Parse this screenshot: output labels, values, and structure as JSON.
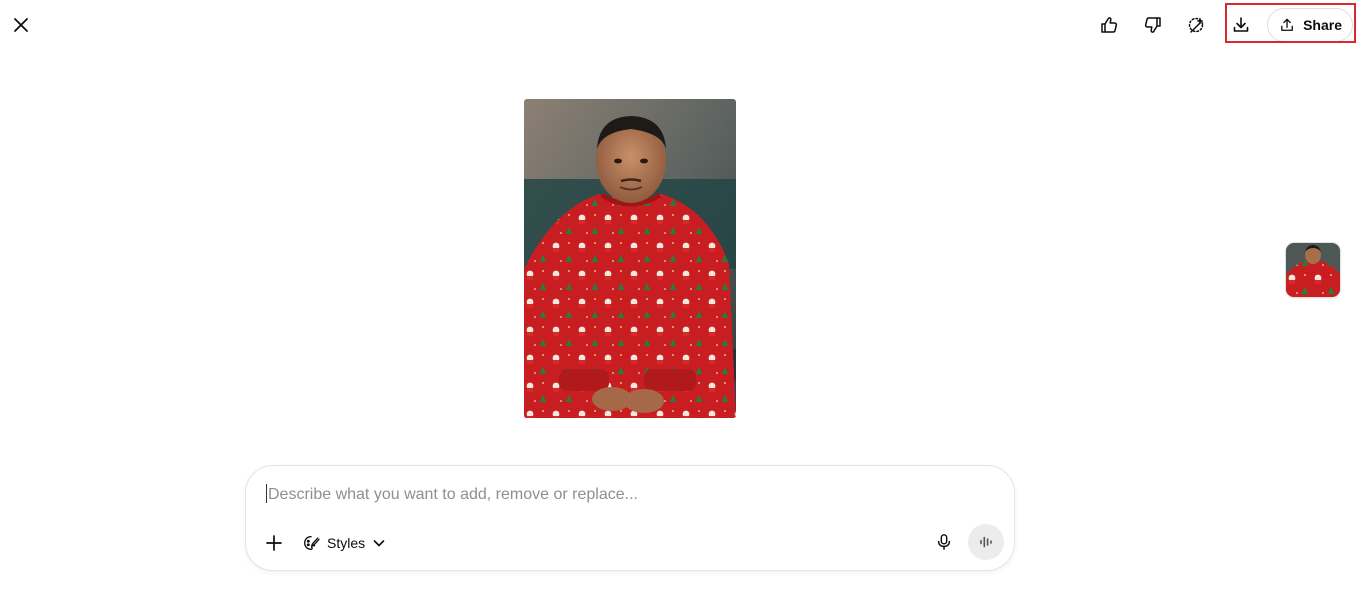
{
  "toolbar": {
    "close_icon": "close-icon",
    "like_icon": "thumbs-up-icon",
    "dislike_icon": "thumbs-down-icon",
    "select_icon": "magic-select-icon",
    "download_icon": "download-icon",
    "share_label": "Share",
    "share_icon": "share-upload-icon"
  },
  "image": {
    "main": "generated-image-man-in-christmas-sweater",
    "thumbnail": "image-thumbnail"
  },
  "composer": {
    "placeholder": "Describe what you want to add, remove or replace...",
    "styles_label": "Styles",
    "plus_icon": "plus-icon",
    "mic_icon": "microphone-icon",
    "voice_icon": "voice-mode-icon"
  },
  "colors": {
    "highlight": "#d6282f",
    "sweater_red": "#cc1f22",
    "background": "#ffffff"
  }
}
